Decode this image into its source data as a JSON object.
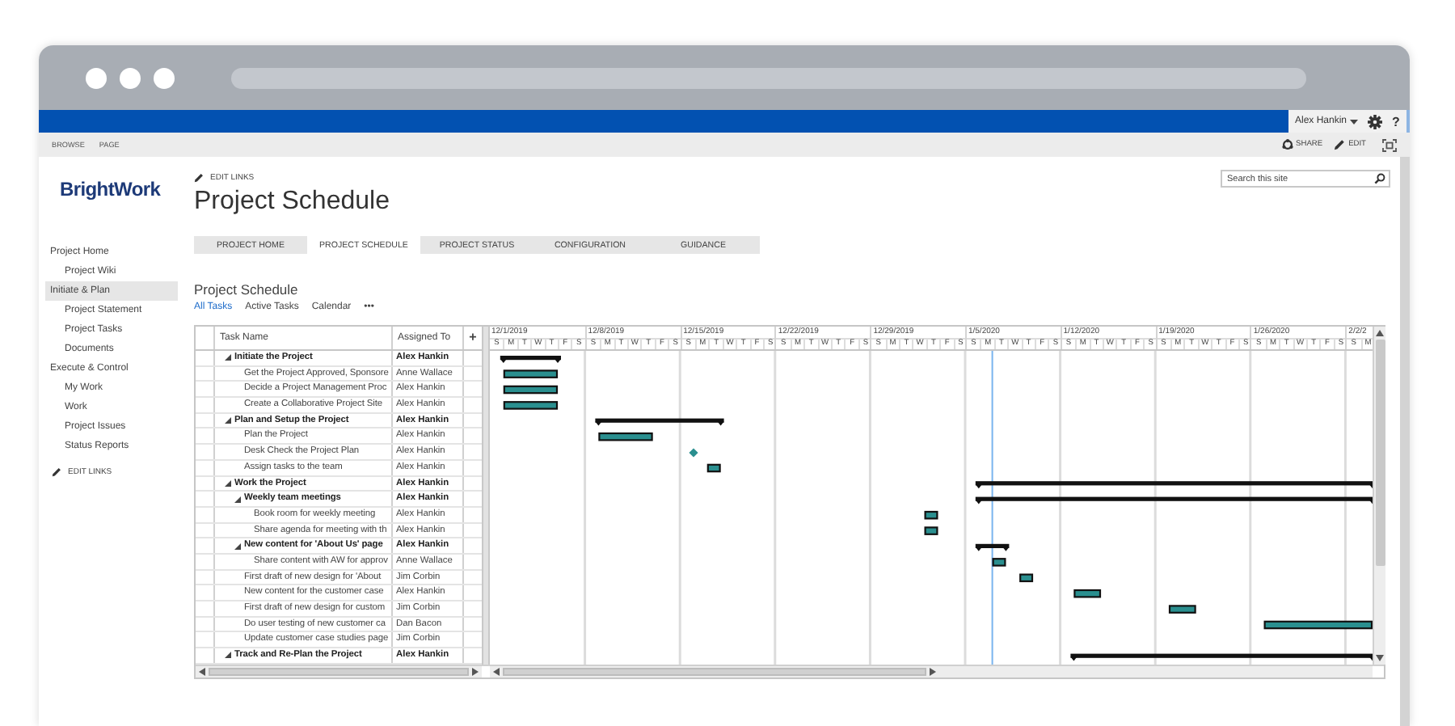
{
  "top_bar": {
    "user": "Alex Hankin",
    "help": "?"
  },
  "ribbon": {
    "tabs": [
      {
        "label": "BROWSE"
      },
      {
        "label": "PAGE"
      }
    ],
    "actions": [
      {
        "kind": "share",
        "label": "SHARE"
      },
      {
        "kind": "edit",
        "label": "EDIT"
      }
    ]
  },
  "logo": "BrightWork",
  "nav": {
    "items": [
      {
        "label": "Project Home",
        "selected": false,
        "children": [
          {
            "label": "Project Wiki",
            "selected": false
          }
        ]
      },
      {
        "label": "Initiate & Plan",
        "selected": true,
        "children": [
          {
            "label": "Project Statement",
            "selected": false
          },
          {
            "label": "Project Tasks",
            "selected": false
          },
          {
            "label": "Documents",
            "selected": false
          }
        ]
      },
      {
        "label": "Execute & Control",
        "selected": false,
        "children": [
          {
            "label": "My Work",
            "selected": false
          },
          {
            "label": "Work",
            "selected": false
          },
          {
            "label": "Project Issues",
            "selected": false
          },
          {
            "label": "Status Reports",
            "selected": false
          }
        ]
      }
    ],
    "edit_links": "EDIT LINKS"
  },
  "page": {
    "edit_links": "EDIT LINKS",
    "title": "Project Schedule",
    "search": {
      "placeholder": "Search this site"
    }
  },
  "tabs": [
    {
      "label": "PROJECT HOME",
      "selected": false
    },
    {
      "label": "PROJECT SCHEDULE",
      "selected": true
    },
    {
      "label": "PROJECT STATUS",
      "selected": false
    },
    {
      "label": "CONFIGURATION",
      "selected": false
    },
    {
      "label": "GUIDANCE",
      "selected": false
    }
  ],
  "schedule": {
    "title": "Project Schedule",
    "views": [
      {
        "label": "All Tasks",
        "selected": true
      },
      {
        "label": "Active Tasks",
        "selected": false
      },
      {
        "label": "Calendar",
        "selected": false
      }
    ],
    "more": "•••",
    "columns": [
      "Task Name",
      "Assigned To"
    ],
    "add_column": "+",
    "weeks": [
      {
        "label": "12/1/2019",
        "days": [
          "S",
          "M",
          "T",
          "W",
          "T",
          "F",
          "S"
        ]
      },
      {
        "label": "12/8/2019",
        "days": [
          "S",
          "M",
          "T",
          "W",
          "T",
          "F",
          "S"
        ]
      },
      {
        "label": "12/15/2019",
        "days": [
          "S",
          "M",
          "T",
          "W",
          "T",
          "F",
          "S"
        ]
      },
      {
        "label": "12/22/2019",
        "days": [
          "S",
          "M",
          "T",
          "W",
          "T",
          "F",
          "S"
        ]
      },
      {
        "label": "12/29/2019",
        "days": [
          "S",
          "M",
          "T",
          "W",
          "T",
          "F",
          "S"
        ]
      },
      {
        "label": "1/5/2020",
        "days": [
          "S",
          "M",
          "T",
          "W",
          "T",
          "F",
          "S"
        ]
      },
      {
        "label": "1/12/2020",
        "days": [
          "S",
          "M",
          "T",
          "W",
          "T",
          "F",
          "S"
        ]
      },
      {
        "label": "1/19/2020",
        "days": [
          "S",
          "M",
          "T",
          "W",
          "T",
          "F",
          "S"
        ]
      },
      {
        "label": "1/26/2020",
        "days": [
          "S",
          "M",
          "T",
          "W",
          "T",
          "F",
          "S"
        ]
      },
      {
        "label": "2/2/2",
        "days": [
          "S",
          "M"
        ]
      }
    ],
    "tasks": [
      {
        "name": "Initiate the Project",
        "assigned_to": "Alex Hankin",
        "kind": "summary",
        "expanded": true,
        "children": [
          {
            "name": "Get the Project Approved, Sponsore",
            "assigned_to": "Anne Wallace",
            "kind": "task"
          },
          {
            "name": "Decide a Project Management Proc",
            "assigned_to": "Alex Hankin",
            "kind": "task"
          },
          {
            "name": "Create a Collaborative Project Site",
            "assigned_to": "Alex Hankin",
            "kind": "task"
          }
        ]
      },
      {
        "name": "Plan and Setup the Project",
        "assigned_to": "Alex Hankin",
        "kind": "summary",
        "expanded": true,
        "children": [
          {
            "name": "Plan the Project",
            "assigned_to": "Alex Hankin",
            "kind": "task"
          },
          {
            "name": "Desk Check the Project Plan",
            "assigned_to": "Alex Hankin",
            "kind": "milestone"
          },
          {
            "name": "Assign tasks to the team",
            "assigned_to": "Alex Hankin",
            "kind": "task"
          }
        ]
      },
      {
        "name": "Work the Project",
        "assigned_to": "Alex Hankin",
        "kind": "summary",
        "expanded": true,
        "children": [
          {
            "name": "Weekly team meetings",
            "assigned_to": "Alex Hankin",
            "kind": "summary",
            "expanded": true,
            "children": [
              {
                "name": "Book room for weekly meeting",
                "assigned_to": "Alex Hankin",
                "kind": "task"
              },
              {
                "name": "Share agenda for meeting with th",
                "assigned_to": "Alex Hankin",
                "kind": "task"
              }
            ]
          },
          {
            "name": "New content for 'About Us' page",
            "assigned_to": "Alex Hankin",
            "kind": "summary",
            "expanded": true,
            "children": [
              {
                "name": "Share content with AW for approv",
                "assigned_to": "Anne Wallace",
                "kind": "task"
              }
            ]
          },
          {
            "name": "First draft of new design for 'About",
            "assigned_to": "Jim Corbin",
            "kind": "task"
          },
          {
            "name": "New content for the customer case",
            "assigned_to": "Alex Hankin",
            "kind": "task"
          },
          {
            "name": "First draft of new design for custom",
            "assigned_to": "Jim Corbin",
            "kind": "task"
          },
          {
            "name": "Do user testing of new customer ca",
            "assigned_to": "Dan Bacon",
            "kind": "task"
          },
          {
            "name": "Update customer case studies page",
            "assigned_to": "Jim Corbin",
            "kind": "task"
          }
        ]
      },
      {
        "name": "Track and Re-Plan the Project",
        "assigned_to": "Alex Hankin",
        "kind": "summary",
        "expanded": true
      }
    ]
  }
}
